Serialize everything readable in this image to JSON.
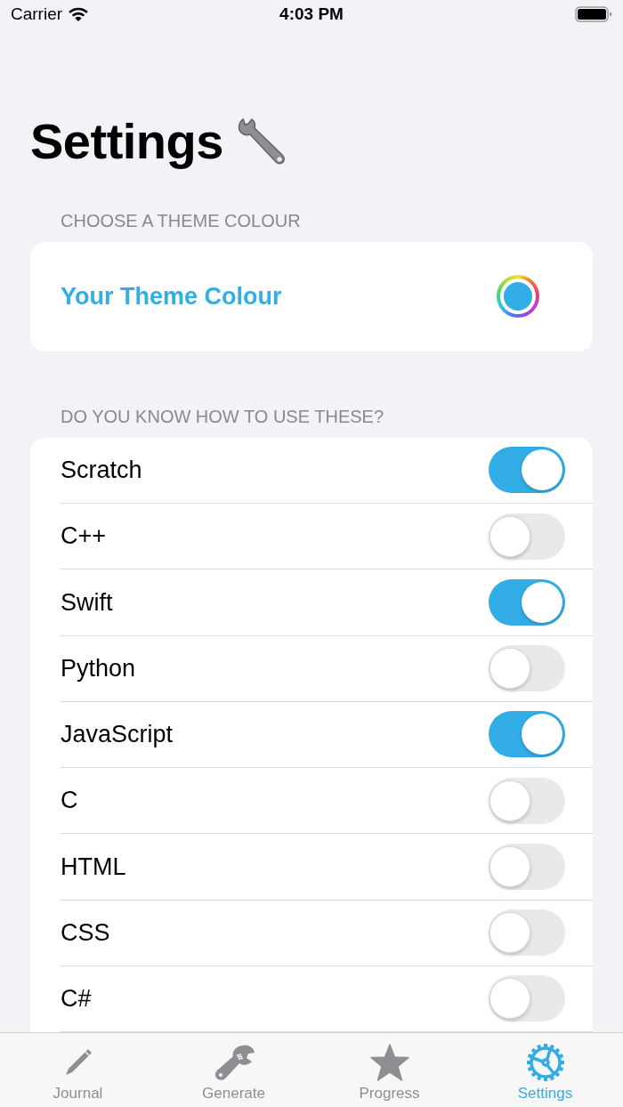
{
  "status_bar": {
    "carrier": "Carrier",
    "time": "4:03 PM"
  },
  "title": "Settings",
  "theme_section": {
    "header": "CHOOSE A THEME COLOUR",
    "label": "Your Theme Colour",
    "color": "#32ade6"
  },
  "languages_section": {
    "header": "DO YOU KNOW HOW TO USE THESE?",
    "items": [
      {
        "label": "Scratch",
        "on": true
      },
      {
        "label": "C++",
        "on": false
      },
      {
        "label": "Swift",
        "on": true
      },
      {
        "label": "Python",
        "on": false
      },
      {
        "label": "JavaScript",
        "on": true
      },
      {
        "label": "C",
        "on": false
      },
      {
        "label": "HTML",
        "on": false
      },
      {
        "label": "CSS",
        "on": false
      },
      {
        "label": "C#",
        "on": false
      }
    ]
  },
  "tab_bar": {
    "tabs": [
      {
        "label": "Journal",
        "selected": false
      },
      {
        "label": "Generate",
        "selected": false
      },
      {
        "label": "Progress",
        "selected": false
      },
      {
        "label": "Settings",
        "selected": true
      }
    ]
  }
}
